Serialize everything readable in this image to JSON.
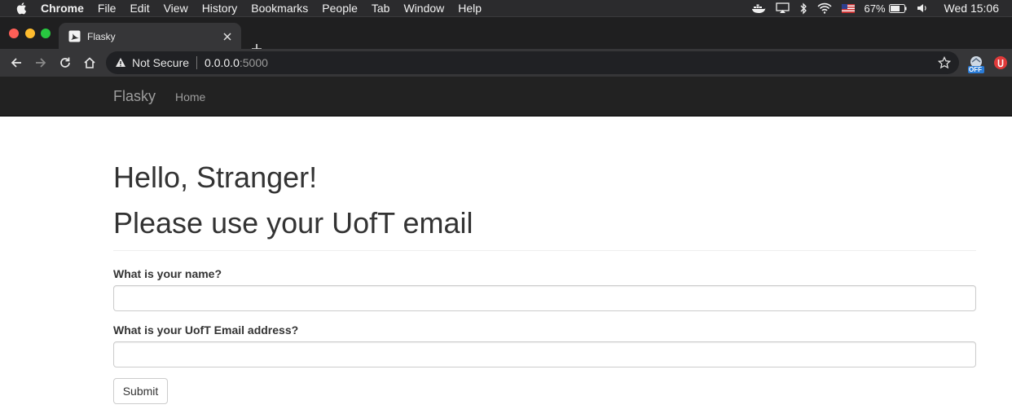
{
  "menubar": {
    "items": [
      "Chrome",
      "File",
      "Edit",
      "View",
      "History",
      "Bookmarks",
      "People",
      "Tab",
      "Window",
      "Help"
    ],
    "battery": "67%",
    "clock": "Wed 15:06"
  },
  "tab": {
    "title": "Flasky"
  },
  "omnibox": {
    "security_label": "Not Secure",
    "host": "0.0.0.0",
    "port": ":5000"
  },
  "extensions": {
    "badge": "OFF"
  },
  "navbar": {
    "brand": "Flasky",
    "home": "Home"
  },
  "page": {
    "greeting": "Hello, Stranger!",
    "instruction": "Please use your UofT email"
  },
  "form": {
    "name_label": "What is your name?",
    "name_value": "",
    "email_label": "What is your UofT Email address?",
    "email_value": "",
    "submit_label": "Submit"
  },
  "colors": {
    "navbar_bg": "#222222",
    "navbar_text": "#9d9d9d",
    "heading_text": "#333333"
  }
}
